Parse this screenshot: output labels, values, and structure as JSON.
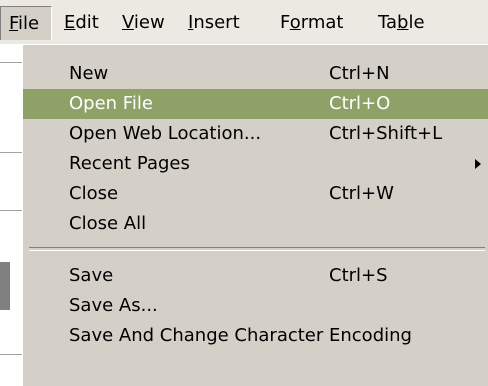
{
  "menubar": {
    "items": [
      {
        "label": "File",
        "mnemonic": "F"
      },
      {
        "label": "Edit",
        "mnemonic": "E"
      },
      {
        "label": "View",
        "mnemonic": "V"
      },
      {
        "label": "Insert",
        "mnemonic": "I"
      },
      {
        "label": "Format",
        "mnemonic": "o"
      },
      {
        "label": "Table",
        "mnemonic": "b"
      }
    ]
  },
  "file_menu": {
    "items": [
      {
        "label": "New",
        "shortcut": "Ctrl+N",
        "highlighted": false,
        "has_submenu": false
      },
      {
        "label": "Open File",
        "shortcut": "Ctrl+O",
        "highlighted": true,
        "has_submenu": false
      },
      {
        "label": "Open Web Location...",
        "shortcut": "Ctrl+Shift+L",
        "highlighted": false,
        "has_submenu": false
      },
      {
        "label": "Recent Pages",
        "shortcut": "",
        "highlighted": false,
        "has_submenu": true
      },
      {
        "label": "Close",
        "shortcut": "Ctrl+W",
        "highlighted": false,
        "has_submenu": false
      },
      {
        "label": "Close All",
        "shortcut": "",
        "highlighted": false,
        "has_submenu": false
      },
      {
        "label": "Save",
        "shortcut": "Ctrl+S",
        "highlighted": false,
        "has_submenu": false
      },
      {
        "label": "Save As...",
        "shortcut": "",
        "highlighted": false,
        "has_submenu": false
      },
      {
        "label": "Save And Change Character Encoding",
        "shortcut": "",
        "highlighted": false,
        "has_submenu": false
      }
    ]
  },
  "colors": {
    "menu_background": "#d4d0c8",
    "menubar_background": "#ebe9e1",
    "highlight_background": "#8ea166",
    "highlight_text": "#ffffff"
  }
}
